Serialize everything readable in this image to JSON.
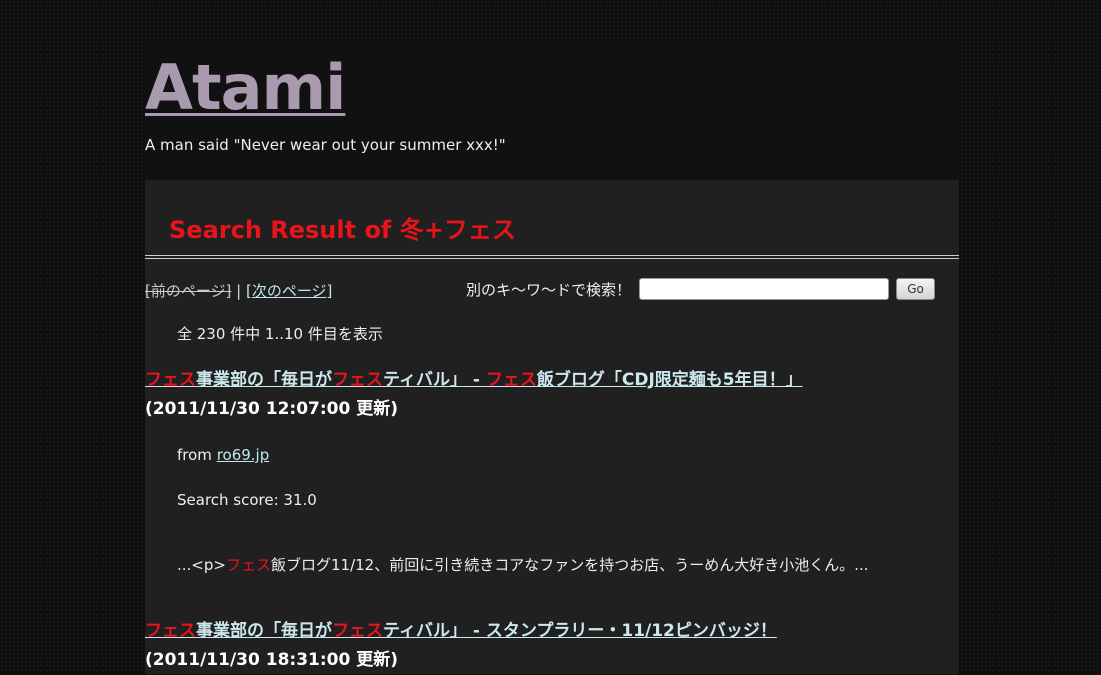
{
  "site": {
    "title": "Atami",
    "tagline": "A man said \"Never wear out your summer xxx!\""
  },
  "search": {
    "heading_prefix": "Search Result of ",
    "query": "冬+フェス",
    "prev_label": "[前のページ]",
    "separator": " | ",
    "next_label": "[次のページ]",
    "prompt": "別のキ～ワ～ドで検索！",
    "input_value": "",
    "go_label": "Go",
    "count_text": "全 230 件中 1..10 件目を表示"
  },
  "results": [
    {
      "title_parts": [
        "フェス",
        "事業部の「毎日が",
        "フェス",
        "ティバル」 - ",
        "フェス",
        "飯ブログ「CDJ限定麺も5年目！」"
      ],
      "date": "(2011/11/30 12:07:00 更新)",
      "from_label": "from ",
      "source": "ro69.jp",
      "score": "Search score: 31.0",
      "snippet_parts": [
        "...<p>",
        "フェス",
        "飯ブログ11/12、前回に引き続きコアなファンを持つお店、うーめん大好き小池くん。..."
      ]
    },
    {
      "title_parts": [
        "フェス",
        "事業部の「毎日が",
        "フェス",
        "ティバル」 - スタンプラリー・11/12ピンバッジ！"
      ],
      "date": "(2011/11/30 18:31:00 更新)"
    }
  ]
}
